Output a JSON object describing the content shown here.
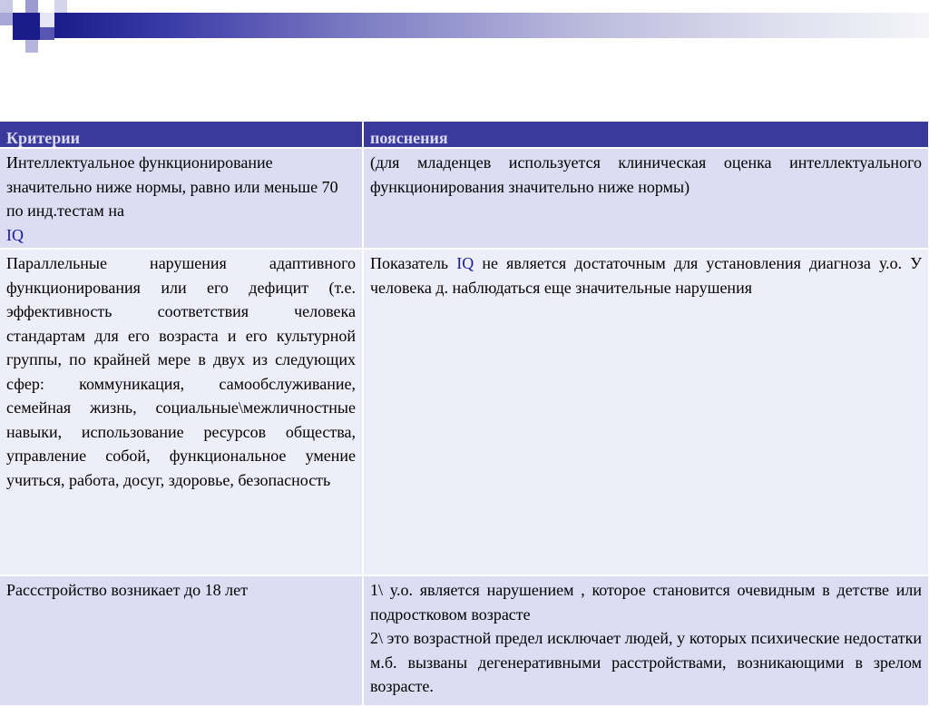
{
  "table": {
    "headers": [
      "Критерии",
      "пояснения"
    ],
    "rows": [
      {
        "criterion_text": "Интеллектуальное функционирование значительно  ниже нормы, равно или меньше 70 по инд.тестам на",
        "criterion_iq": "IQ",
        "explanation": "(для младенцев используется клиническая оценка интеллектуального функционирования значительно ниже нормы)"
      },
      {
        "criterion_text": "Параллельные нарушения адаптивного функционирования или его дефицит (т.е. эффективность соответствия человека стандартам для его возраста и его культурной группы, по крайней мере в двух из следующих сфер: коммуникация, самообслуживание, семейная жизнь, социальные\\межличностные навыки, использование ресурсов общества, управление собой, функциональное умение учиться, работа, досуг, здоровье, безопасность",
        "explanation_before": "Показатель",
        "explanation_iq": "IQ",
        "explanation_after": "не является достаточным для установления диагноза у.о. У человека д. наблюдаться еще значительные нарушения"
      },
      {
        "criterion_text": "Рассстройство возникает до 18 лет",
        "explanation_1": "1\\ у.о. является нарушением , которое становится очевидным в детстве или подростковом возрасте",
        "explanation_2": "2\\ это возрастной предел исключает людей, у которых психические недостатки м.б. вызваны дегенеративными расстройствами, возникающими в зрелом возрасте."
      }
    ]
  },
  "colors": {
    "header_bg": "#3a3a9c",
    "header_text": "#d9d9f2",
    "row_dark": "#dcdcf2",
    "row_light": "#eeeef9",
    "iq_text": "#1a1aa0"
  }
}
